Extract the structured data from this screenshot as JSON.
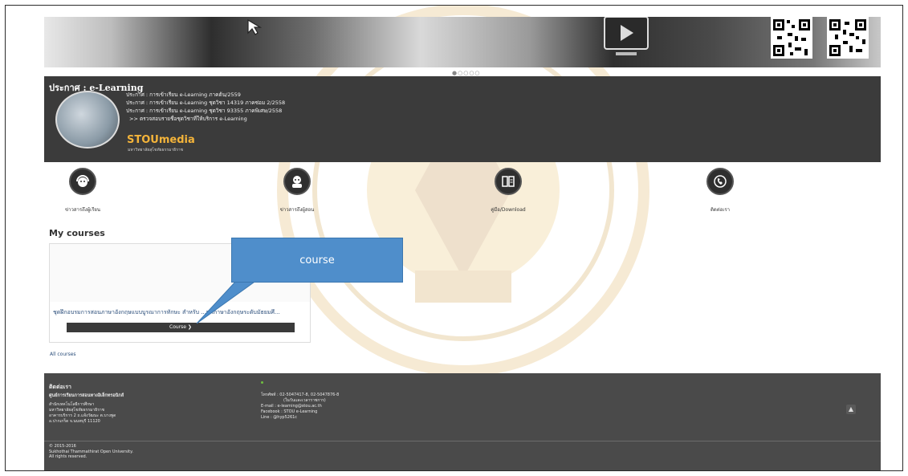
{
  "announcement": {
    "title": "ประกาศ : e-Learning",
    "lines": [
      "ประกาศ : การเข้าเรียน e-Learning ภาคต้น/2559",
      "ประกาศ : การเข้าเรียน e-Learning ชุดวิชา 14319 ภาคซ่อม 2/2558",
      "ประกาศ : การเข้าเรียน e-Learning ชุดวิชา 93355 ภาคพิเศษ/2558",
      ">> ตรวจสอบรายชื่อชุดวิชาที่ให้บริการ e-Learning"
    ],
    "brand": "STOUmedia",
    "brand_sub": "มหาวิทยาลัยสุโขทัยธรรมาธิราช"
  },
  "icons": [
    {
      "label": "ข่าวสารถึงผู้เรียน",
      "icon": "student-headset-icon"
    },
    {
      "label": "ข่าวสารถึงผู้สอน",
      "icon": "teacher-icon"
    },
    {
      "label": "คู่มือ/Download",
      "icon": "manual-download-icon"
    },
    {
      "label": "ติดต่อเรา",
      "icon": "phone-contact-icon"
    }
  ],
  "my_courses": {
    "title": "My courses",
    "course_title": "ชุดฝึกอบรมการสอนภาษาอังกฤษแบบบูรณาการทักษะ สำหรับ ...ษาภาษาอังกฤษระดับมัธยมศึ...",
    "course_button": "Course ❯",
    "all_courses": "All courses"
  },
  "callout": {
    "text": "course",
    "color": "#4f8ecb"
  },
  "footer": {
    "contact_title": "ติดต่อเรา",
    "org": "ศูนย์การเรียนการสอนทางอิเล็กทรอนิกส์",
    "address": [
      "สำนักเทคโนโลยีการศึกษา",
      "มหาวิทยาลัยสุโขทัยธรรมาธิราช",
      "อาคารบริการ 2 ถ.แจ้งวัฒนะ ต.บางพูด",
      "อ.ปากเกร็ด จ.นนทบุรี 11120"
    ],
    "phone_lines": [
      "โทรศัพท์ : 02-5047417-8, 02-5047876-8",
      "(ในวันและเวลาราชการ)",
      "E-mail : e-learning@stou.ac.th",
      "Facebook : STOU e-Learning",
      "Line : @hyp5261c"
    ],
    "copyright": [
      "© 2015-2016",
      "Sukhothai Thammathirat Open University.",
      "All rights reserved."
    ]
  }
}
